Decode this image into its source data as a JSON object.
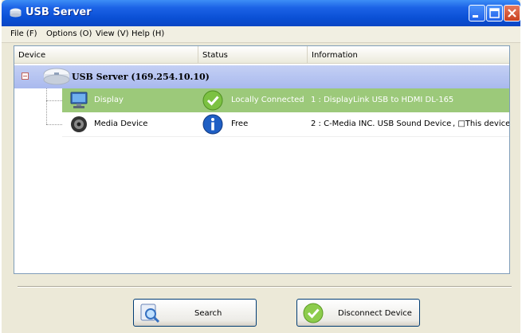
{
  "window": {
    "title": "USB Server",
    "title_icon": "usb-server-icon",
    "accent": "#0a4fd4"
  },
  "menu": {
    "items": [
      {
        "label": "File (F)"
      },
      {
        "label": "Options (O)"
      },
      {
        "label": "View (V)"
      },
      {
        "label": "Help (H)"
      }
    ]
  },
  "list": {
    "columns": [
      "Device",
      "Status",
      "Information"
    ],
    "server": {
      "label": "USB Server  (169.254.10.10)",
      "icon": "server-icon",
      "expanded": true
    },
    "devices": [
      {
        "name": "Display",
        "icon": "monitor-icon",
        "status": "Locally Connected",
        "status_icon": "checkmark-icon",
        "info": "1 : DisplayLink USB to HDMI DL-165",
        "extra": "",
        "selected": true,
        "highlight_color": "#9cc97a"
      },
      {
        "name": "Media Device",
        "icon": "speaker-icon",
        "status": "Free",
        "status_icon": "info-icon",
        "info": "2 : C-Media INC. USB Sound Device",
        "extra": ", □This device...",
        "selected": false,
        "highlight_color": "#ffffff"
      }
    ]
  },
  "buttons": {
    "search_label": "Search",
    "disconnect_label": "Disconnect Device"
  }
}
